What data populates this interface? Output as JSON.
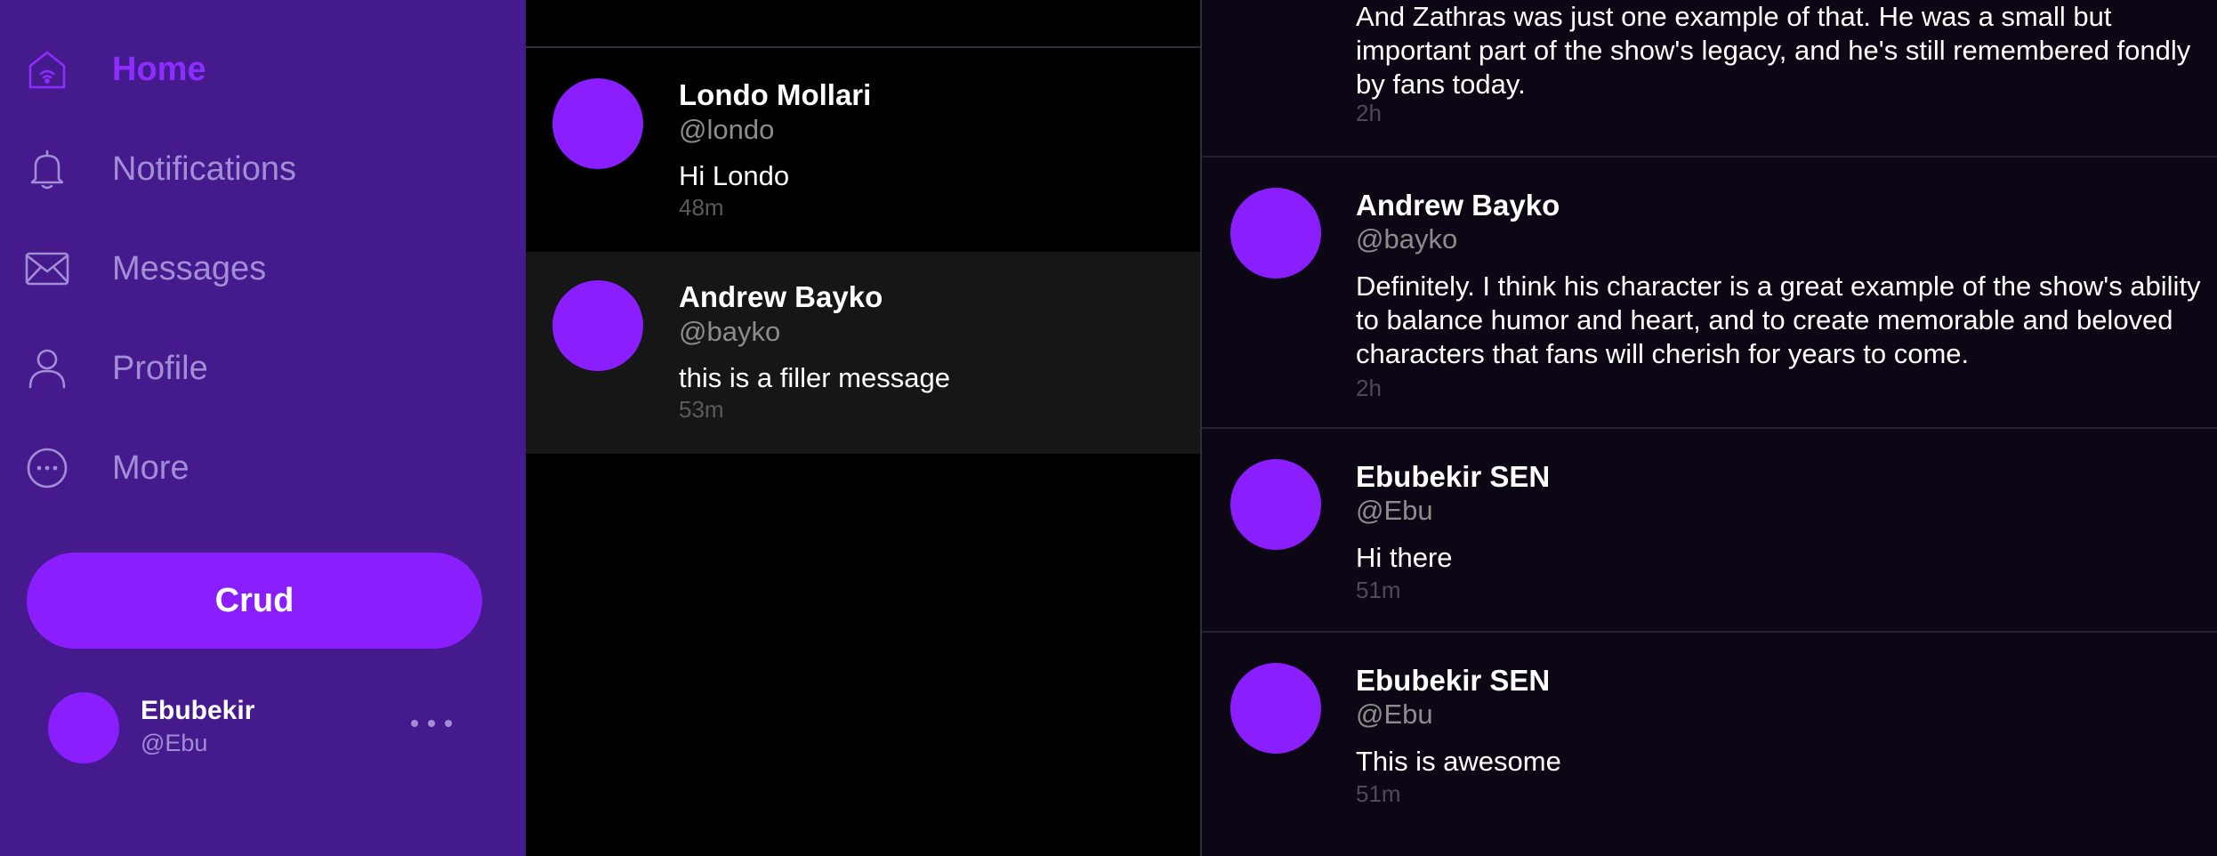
{
  "sidebar": {
    "nav": [
      {
        "label": "Home",
        "icon": "home-icon",
        "active": true
      },
      {
        "label": "Notifications",
        "icon": "bell-icon",
        "active": false
      },
      {
        "label": "Messages",
        "icon": "envelope-icon",
        "active": false
      },
      {
        "label": "Profile",
        "icon": "person-icon",
        "active": false
      },
      {
        "label": "More",
        "icon": "more-circle-icon",
        "active": false
      }
    ],
    "crud_label": "Crud",
    "account": {
      "name": "Ebubekir",
      "handle": "@Ebu",
      "menu_icon": "ellipsis-icon"
    }
  },
  "conversations": [
    {
      "name": "Londo Mollari",
      "handle": "@londo",
      "preview": "Hi Londo",
      "time": "48m",
      "selected": false
    },
    {
      "name": "Andrew Bayko",
      "handle": "@bayko",
      "preview": "this is a filler message",
      "time": "53m",
      "selected": true
    }
  ],
  "thread": {
    "messages": [
      {
        "name": "",
        "handle": "",
        "text": "And Zathras was just one example of that. He was a small but important part of the show's legacy, and he's still remembered fondly by fans today.",
        "time": "2h"
      },
      {
        "name": "Andrew Bayko",
        "handle": "@bayko",
        "text": "Definitely. I think his character is a great example of the show's ability to balance humor and heart, and to create memorable and beloved characters that fans will cherish for years to come.",
        "time": "2h"
      },
      {
        "name": "Ebubekir SEN",
        "handle": "@Ebu",
        "text": "Hi there",
        "time": "51m"
      },
      {
        "name": "Ebubekir SEN",
        "handle": "@Ebu",
        "text": "This is awesome",
        "time": "51m"
      }
    ]
  },
  "colors": {
    "sidebar_bg": "#441a8c",
    "accent": "#8a1eff",
    "muted_text": "#a38dd6",
    "selected_row": "#161616",
    "thread_bg": "#0d0614"
  }
}
